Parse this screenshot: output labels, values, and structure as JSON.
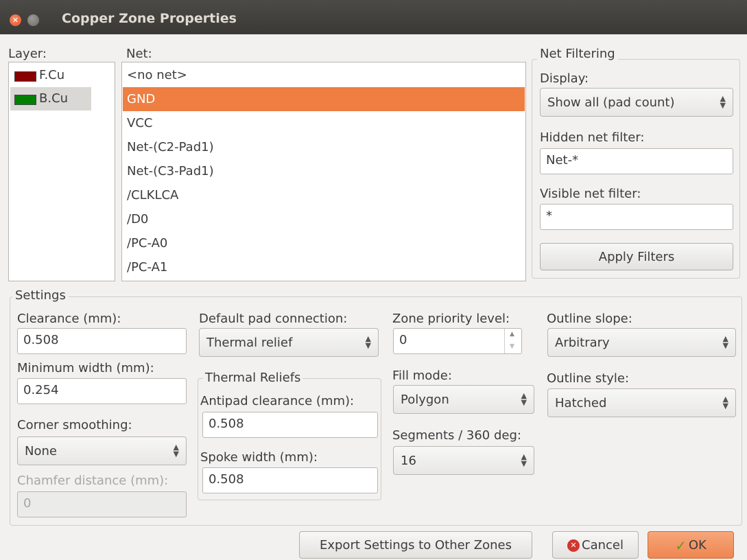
{
  "window": {
    "title": "Copper Zone Properties"
  },
  "layers": {
    "label": "Layer:",
    "items": [
      {
        "name": "F.Cu",
        "color": "#8b0000"
      },
      {
        "name": "B.Cu",
        "color": "#008000"
      }
    ],
    "selected": "B.Cu"
  },
  "nets": {
    "label": "Net:",
    "items": [
      "<no net>",
      "GND",
      "VCC",
      "Net-(C2-Pad1)",
      "Net-(C3-Pad1)",
      "/CLKLCA",
      "/D0",
      "/PC-A0",
      "/PC-A1"
    ],
    "selected": "GND"
  },
  "net_filtering": {
    "title": "Net Filtering",
    "display_label": "Display:",
    "display_value": "Show all (pad count)",
    "hidden_label": "Hidden net filter:",
    "hidden_value": "Net-*",
    "visible_label": "Visible net filter:",
    "visible_value": "*",
    "apply_button": "Apply Filters"
  },
  "settings": {
    "title": "Settings",
    "clearance_label": "Clearance (mm):",
    "clearance_value": "0.508",
    "min_width_label": "Minimum width (mm):",
    "min_width_value": "0.254",
    "corner_label": "Corner smoothing:",
    "corner_value": "None",
    "chamfer_label": "Chamfer distance (mm):",
    "chamfer_value": "0",
    "pad_conn_label": "Default pad connection:",
    "pad_conn_value": "Thermal relief",
    "thermal_title": "Thermal Reliefs",
    "antipad_label": "Antipad clearance (mm):",
    "antipad_value": "0.508",
    "spoke_label": "Spoke width (mm):",
    "spoke_value": "0.508",
    "priority_label": "Zone priority level:",
    "priority_value": "0",
    "fill_label": "Fill mode:",
    "fill_value": "Polygon",
    "segments_label": "Segments / 360 deg:",
    "segments_value": "16",
    "slope_label": "Outline slope:",
    "slope_value": "Arbitrary",
    "style_label": "Outline style:",
    "style_value": "Hatched"
  },
  "buttons": {
    "export": "Export Settings to Other Zones",
    "cancel": "Cancel",
    "ok": "OK"
  },
  "icons": {
    "close": "close-icon",
    "minimize": "minimize-icon",
    "cancel": "cancel-icon",
    "ok": "checkmark-icon"
  }
}
